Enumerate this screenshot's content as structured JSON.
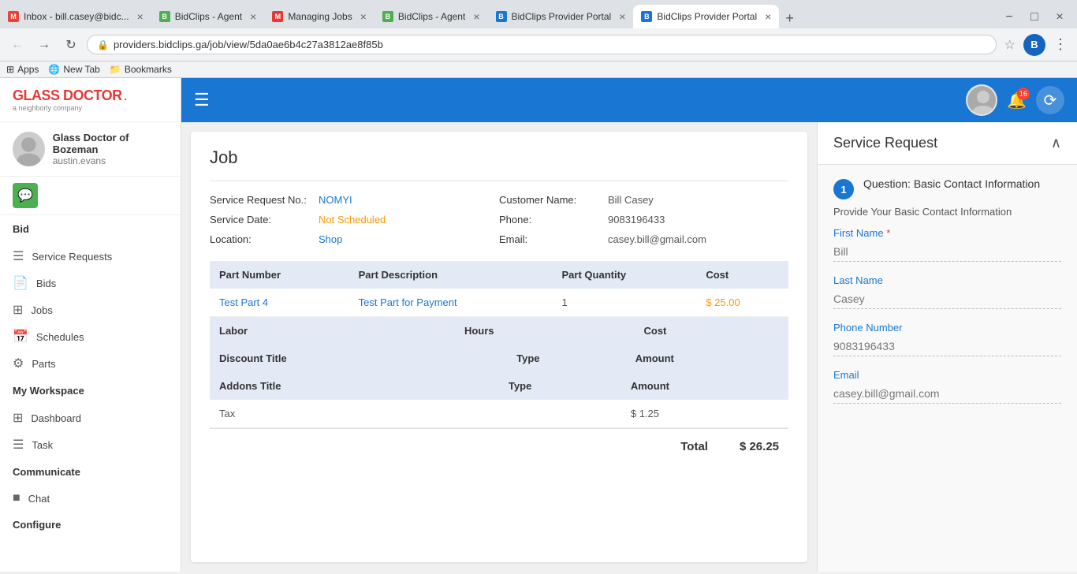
{
  "browser": {
    "tabs": [
      {
        "id": "tab1",
        "favicon_color": "#EA4335",
        "favicon_letter": "M",
        "title": "Inbox - bill.casey@bidc...",
        "active": false,
        "closeable": true
      },
      {
        "id": "tab2",
        "favicon_color": "#4CAF50",
        "favicon_letter": "B",
        "title": "BidClips - Agent",
        "active": false,
        "closeable": true
      },
      {
        "id": "tab3",
        "favicon_color": "#E53935",
        "favicon_letter": "M",
        "title": "Managing Jobs",
        "active": false,
        "closeable": true
      },
      {
        "id": "tab4",
        "favicon_color": "#4CAF50",
        "favicon_letter": "B",
        "title": "BidClips - Agent",
        "active": false,
        "closeable": true
      },
      {
        "id": "tab5",
        "favicon_color": "#1976d2",
        "favicon_letter": "B",
        "title": "BidClips Provider Portal",
        "active": false,
        "closeable": true
      },
      {
        "id": "tab6",
        "favicon_color": "#1976d2",
        "favicon_letter": "B",
        "title": "BidClips Provider Portal",
        "active": true,
        "closeable": true
      }
    ],
    "address": "providers.bidclips.ga/job/view/5da0ae6b4c27a3812ae8f85b",
    "bookmarks": [
      "Apps",
      "New Tab",
      "Bookmarks"
    ]
  },
  "sidebar": {
    "logo": {
      "top_text": "GLASS DOCTOR",
      "sub_text": "a neighborly company"
    },
    "profile": {
      "name": "Glass Doctor of Bozeman",
      "username": "austin.evans"
    },
    "sections": [
      {
        "title": "Bid",
        "items": [
          {
            "icon": "☰",
            "label": "Service Requests"
          },
          {
            "icon": "📄",
            "label": "Bids"
          },
          {
            "icon": "⊞",
            "label": "Jobs"
          },
          {
            "icon": "📅",
            "label": "Schedules"
          },
          {
            "icon": "⚙",
            "label": "Parts"
          }
        ]
      },
      {
        "title": "My Workspace",
        "items": [
          {
            "icon": "⊞",
            "label": "Dashboard"
          },
          {
            "icon": "☰",
            "label": "Task"
          }
        ]
      },
      {
        "title": "Communicate",
        "items": [
          {
            "icon": "■",
            "label": "Chat"
          }
        ]
      },
      {
        "title": "Configure",
        "items": []
      }
    ]
  },
  "topbar": {
    "notification_count": "16"
  },
  "job": {
    "title": "Job",
    "service_request_no_label": "Service Request No.:",
    "service_request_no_value": "NOMYI",
    "service_date_label": "Service Date:",
    "service_date_value": "Not Scheduled",
    "location_label": "Location:",
    "location_value": "Shop",
    "customer_name_label": "Customer Name:",
    "customer_name_value": "Bill Casey",
    "phone_label": "Phone:",
    "phone_value": "9083196433",
    "email_label": "Email:",
    "email_value": "casey.bill@gmail.com",
    "table": {
      "parts_headers": [
        "Part Number",
        "Part Description",
        "Part Quantity",
        "Cost"
      ],
      "parts_rows": [
        {
          "number": "Test Part 4",
          "description": "Test Part for Payment",
          "quantity": "1",
          "cost": "$ 25.00"
        }
      ],
      "labor_headers": [
        "Labor",
        "",
        "Hours",
        "Cost"
      ],
      "discount_headers": [
        "Discount Title",
        "",
        "Type",
        "Amount"
      ],
      "addons_headers": [
        "Addons Title",
        "",
        "Type",
        "Amount"
      ],
      "tax_label": "Tax",
      "tax_value": "$ 1.25",
      "total_label": "Total",
      "total_value": "$ 26.25"
    }
  },
  "service_request": {
    "title": "Service Request",
    "step_number": "1",
    "step_label": "Question: Basic Contact Information",
    "form_subtitle": "Provide Your Basic Contact Information",
    "fields": [
      {
        "label": "First Name",
        "required": true,
        "value": "Bill"
      },
      {
        "label": "Last Name",
        "required": false,
        "value": "Casey"
      },
      {
        "label": "Phone Number",
        "required": false,
        "value": "9083196433"
      },
      {
        "label": "Email",
        "required": false,
        "value": "casey.bill@gmail.com"
      }
    ]
  }
}
